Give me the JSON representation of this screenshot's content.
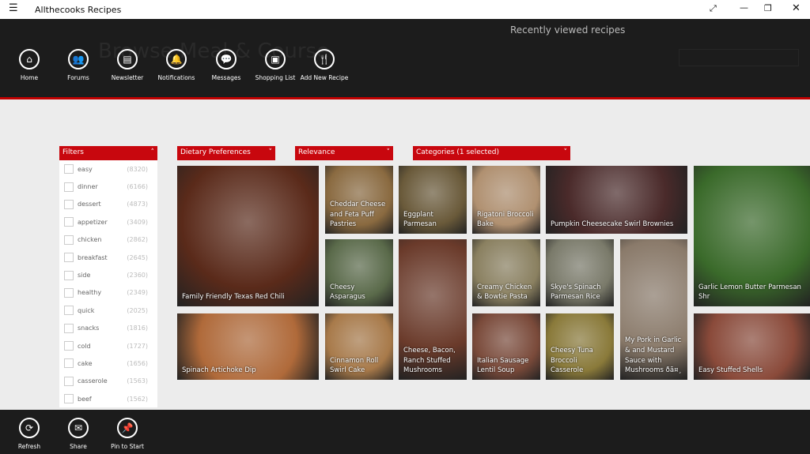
{
  "window": {
    "title": "Allthecooks Recipes",
    "menu_icon": "hamburger-icon",
    "controls": [
      "fullscreen-icon",
      "minimize-icon",
      "restore-icon",
      "close-icon"
    ]
  },
  "header": {
    "background_title": "Browse Meal & Course",
    "recent_label": "Recently viewed recipes",
    "nav": [
      {
        "label": "Home",
        "icon": "home-icon"
      },
      {
        "label": "Forums",
        "icon": "people-icon"
      },
      {
        "label": "Newsletter",
        "icon": "newspaper-icon"
      },
      {
        "label": "Notifications",
        "icon": "bell-icon"
      },
      {
        "label": "Messages",
        "icon": "chat-icon"
      },
      {
        "label": "Shopping List",
        "icon": "bag-icon"
      },
      {
        "label": "Add New Recipe",
        "icon": "fork-knife-icon"
      }
    ]
  },
  "filters": {
    "title": "Filters",
    "items": [
      {
        "label": "easy",
        "count": "(8320)"
      },
      {
        "label": "dinner",
        "count": "(6166)"
      },
      {
        "label": "dessert",
        "count": "(4873)"
      },
      {
        "label": "appetizer",
        "count": "(3409)"
      },
      {
        "label": "chicken",
        "count": "(2862)"
      },
      {
        "label": "breakfast",
        "count": "(2645)"
      },
      {
        "label": "side",
        "count": "(2360)"
      },
      {
        "label": "healthy",
        "count": "(2349)"
      },
      {
        "label": "quick",
        "count": "(2025)"
      },
      {
        "label": "snacks",
        "count": "(1816)"
      },
      {
        "label": "cold",
        "count": "(1727)"
      },
      {
        "label": "cake",
        "count": "(1656)"
      },
      {
        "label": "casserole",
        "count": "(1563)"
      },
      {
        "label": "beef",
        "count": "(1562)"
      }
    ]
  },
  "dropdowns": {
    "dietary": "Dietary Preferences",
    "sort": "Relevance",
    "categories": "Categories (1 selected)"
  },
  "recipes": [
    "Family Friendly Texas Red Chili",
    "Spinach Artichoke Dip",
    "Cheddar Cheese and Feta Puff Pastries",
    "Cheesy Asparagus",
    "Cinnamon Roll Swirl Cake",
    "Eggplant Parmesan",
    "Cheese, Bacon, Ranch Stuffed Mushrooms",
    "Rigatoni Broccoli Bake",
    "Creamy Chicken & Bowtie Pasta",
    "Italian Sausage Lentil Soup",
    "Pumpkin Cheesecake Swirl Brownies",
    "Skye's Spinach Parmesan Rice",
    "Cheesy Tuna Broccoli Casserole",
    "My Pork in Garlic & and Mustard Sauce with Mushrooms ðã¤¸",
    "Garlic Lemon Butter Parmesan Shr",
    "Easy Stuffed Shells"
  ],
  "appbar": [
    {
      "label": "Refresh",
      "icon": "refresh-icon"
    },
    {
      "label": "Share",
      "icon": "share-icon"
    },
    {
      "label": "Pin to Start",
      "icon": "pin-icon"
    }
  ],
  "colors": {
    "accent": "#c8070e",
    "header": "#1c1c1c"
  }
}
